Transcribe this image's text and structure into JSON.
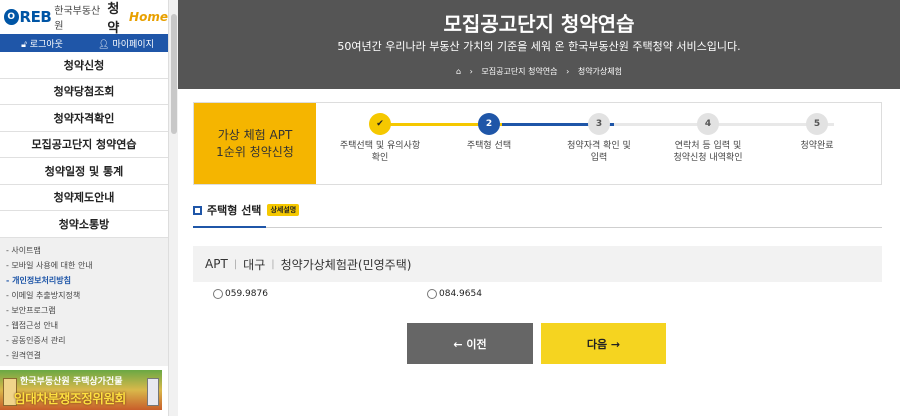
{
  "sidebar": {
    "logo": {
      "mark": "O",
      "reb": "REB",
      "org": "한국부동산원",
      "app": "청약",
      "home": "Home"
    },
    "login": {
      "logout": "로그아웃",
      "mypage": "마이페이지"
    },
    "menu": [
      "청약신청",
      "청약당첨조회",
      "청약자격확인",
      "모집공고단지 청약연습",
      "청약일정 및 통계",
      "청약제도안내",
      "청약소통방"
    ],
    "sub_links": [
      "- 사이트맵",
      "- 모바일 사용에 대한 안내",
      "- 개인정보처리방침",
      "- 이메일 추출방지정책",
      "- 보안프로그램",
      "- 웹접근성 안내",
      "- 공동인증서 관리",
      "- 원격연결"
    ],
    "banner": {
      "line1": "한국부동산원 주택상가건물",
      "line2": "임대차분쟁조정위원회"
    }
  },
  "hero": {
    "title": "모집공고단지 청약연습",
    "subtitle": "50여년간 우리나라 부동산 가치의 기준을 세워 온 한국부동산원 주택청약 서비스입니다.",
    "crumb1": "모집공고단지 청약연습",
    "crumb2": "청약가상체험"
  },
  "steps": {
    "label_line1": "가상 체험 APT",
    "label_line2": "1순위 청약신청",
    "items": [
      {
        "num": "✔",
        "line1": "주택선택 및 유의사항",
        "line2": "확인"
      },
      {
        "num": "2",
        "line1": "주택형 선택",
        "line2": ""
      },
      {
        "num": "3",
        "line1": "청약자격 확인 및",
        "line2": "입력"
      },
      {
        "num": "4",
        "line1": "연락처 등 입력 및",
        "line2": "청약신청 내역확인"
      },
      {
        "num": "5",
        "line1": "청약완료",
        "line2": ""
      }
    ]
  },
  "section": {
    "title": "주택형 선택",
    "badge": "상세설명"
  },
  "apt": {
    "type": "APT",
    "region": "대구",
    "name": "청약가상체험관(민영주택)"
  },
  "options": [
    "059.9876",
    "084.9654"
  ],
  "buttons": {
    "prev": "← 이전",
    "next": "다음 →"
  },
  "colors": {
    "accent_blue": "#1f56a8",
    "accent_yellow": "#f5c800",
    "hero_bg": "#555555"
  }
}
